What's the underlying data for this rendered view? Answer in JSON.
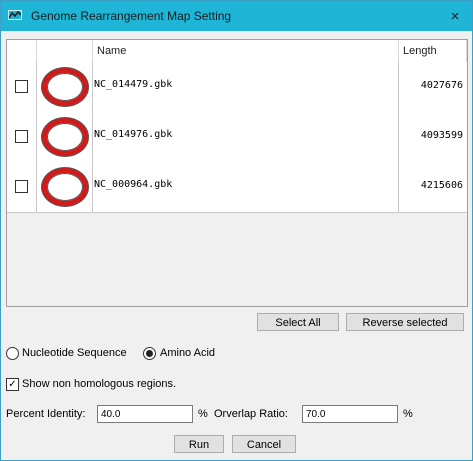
{
  "window": {
    "title": "Genome Rearrangement Map Setting",
    "close_icon": "×"
  },
  "table": {
    "columns": [
      "",
      "",
      "Name",
      "Length"
    ],
    "rows": [
      {
        "name": "NC_014479.gbk",
        "length": "4027676"
      },
      {
        "name": "NC_014976.gbk",
        "length": "4093599"
      },
      {
        "name": "NC_000964.gbk",
        "length": "4215606"
      }
    ]
  },
  "buttons": {
    "select_all": "Select All",
    "reverse_selected": "Reverse selected",
    "run": "Run",
    "cancel": "Cancel"
  },
  "sequence_type": {
    "options": [
      "Nucleotide Sequence",
      "Amino Acid"
    ],
    "selected": "Amino Acid"
  },
  "show_non_homologous": {
    "label": "Show non homologous regions.",
    "checked": true
  },
  "percent_identity": {
    "label": "Percent Identity:",
    "value": "40.0",
    "unit": "%"
  },
  "overlap_ratio": {
    "label": "Orverlap Ratio:",
    "value": "70.0",
    "unit": "%"
  },
  "colors": {
    "titlebar": "#1fb5d6",
    "ring": "#d11a1a"
  }
}
